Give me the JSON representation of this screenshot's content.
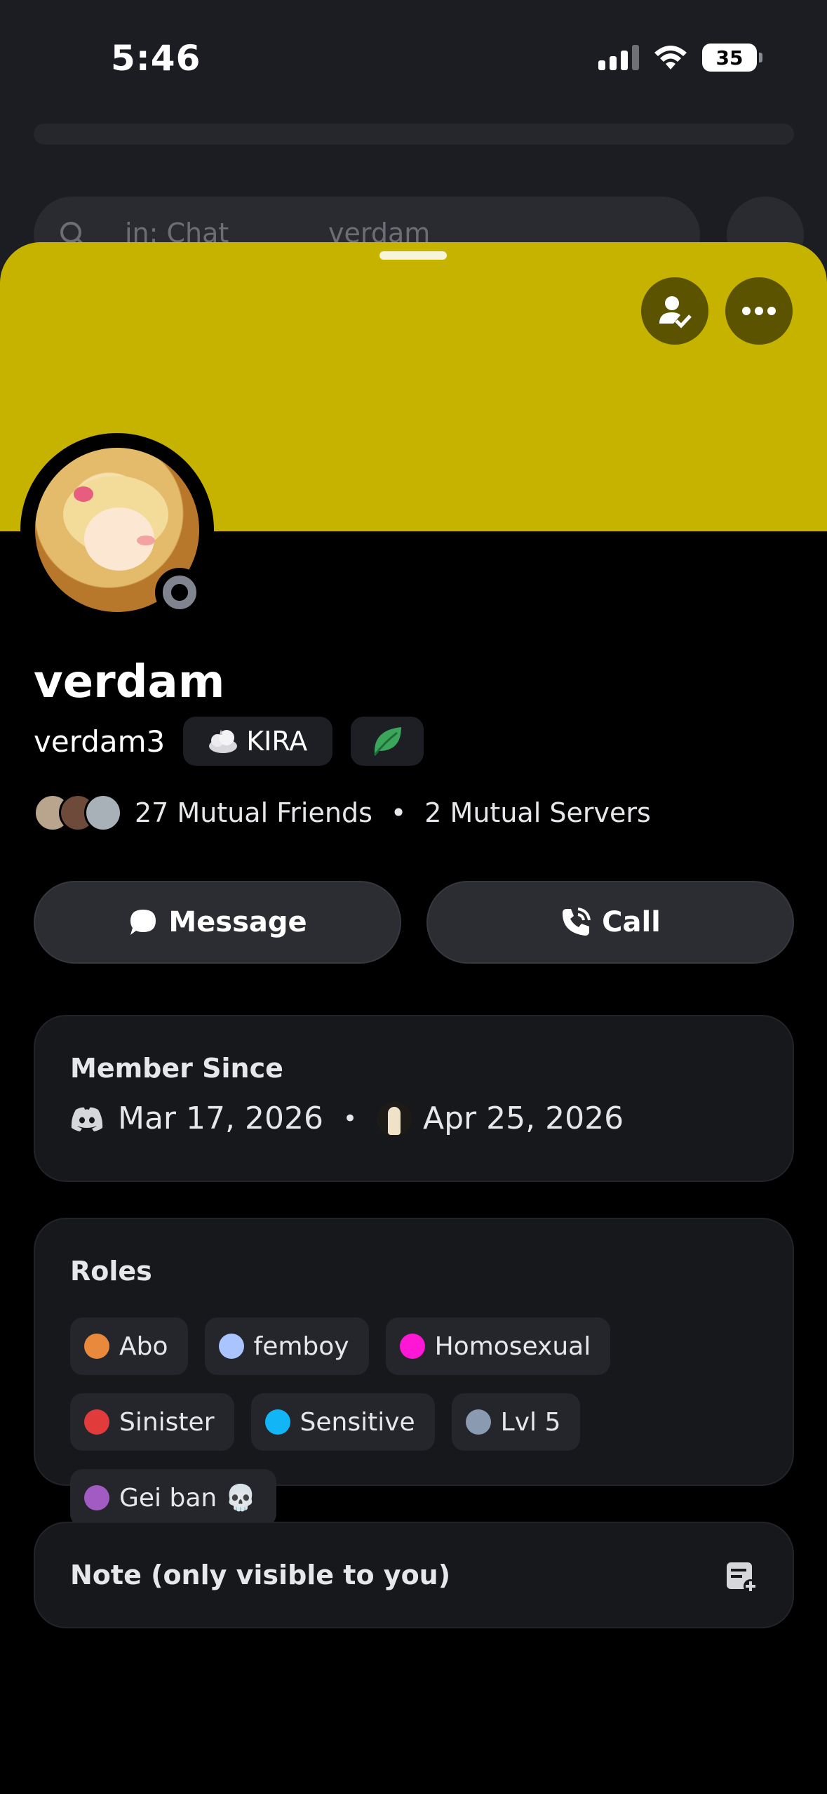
{
  "status_bar": {
    "time": "5:46",
    "battery": "35"
  },
  "background": {
    "search_scope": "in: Chat",
    "search_query": "verdam"
  },
  "profile": {
    "banner_color": "#c6b300",
    "display_name": "verdam",
    "username": "verdam3",
    "guild_tag": "KIRA",
    "mutual_friends": "27 Mutual Friends",
    "mutual_servers": "2 Mutual Servers",
    "separator": "•"
  },
  "actions": {
    "message_label": "Message",
    "call_label": "Call"
  },
  "member_since": {
    "title": "Member Since",
    "discord_date": "Mar 17, 2026",
    "server_date": "Apr 25, 2026",
    "separator": "•"
  },
  "roles": {
    "title": "Roles",
    "items": [
      {
        "label": "Abo",
        "color": "#e8893c"
      },
      {
        "label": "femboy",
        "color": "#a9c4ff"
      },
      {
        "label": "Homosexual",
        "color": "#ff17d6"
      },
      {
        "label": "Sinister",
        "color": "#e23b3b"
      },
      {
        "label": "Sensitive",
        "color": "#12b6f7"
      },
      {
        "label": "Lvl 5",
        "color": "#8a9bb1"
      },
      {
        "label": "Gei ban 💀",
        "color": "#a35bc4"
      }
    ]
  },
  "note": {
    "label": "Note (only visible to you)"
  }
}
